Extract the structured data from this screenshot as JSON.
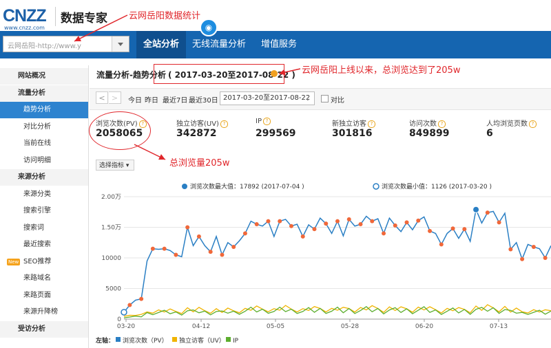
{
  "header": {
    "logo_text": "CNZZ",
    "logo_url": "www.cnzz.com",
    "product": "数据专家",
    "annotation": "云网岳阳数据统计"
  },
  "nav": {
    "site_select_value": "云网岳阳-http://www.y",
    "tabs": [
      "全站分析",
      "无线流量分析",
      "增值服务"
    ],
    "active_tab": 0
  },
  "sidebar": {
    "items": [
      {
        "label": "网站概况",
        "type": "header"
      },
      {
        "label": "流量分析",
        "type": "header"
      },
      {
        "label": "趋势分析",
        "type": "item",
        "active": true
      },
      {
        "label": "对比分析",
        "type": "item"
      },
      {
        "label": "当前在线",
        "type": "item"
      },
      {
        "label": "访问明细",
        "type": "item"
      },
      {
        "label": "来源分析",
        "type": "header"
      },
      {
        "label": "来源分类",
        "type": "item"
      },
      {
        "label": "搜索引擎",
        "type": "item"
      },
      {
        "label": "搜索词",
        "type": "item"
      },
      {
        "label": "最近搜索",
        "type": "item"
      },
      {
        "label": "SEO推荐",
        "type": "item",
        "badge": "New"
      },
      {
        "label": "来路域名",
        "type": "item"
      },
      {
        "label": "来路页面",
        "type": "item"
      },
      {
        "label": "来源升降榜",
        "type": "item"
      },
      {
        "label": "受访分析",
        "type": "header"
      }
    ]
  },
  "content": {
    "page_title": "流量分析-趋势分析",
    "date_range_heading": "( 2017-03-20至2017-08-22 )",
    "annotation_top": "云网岳阳上线以来，总浏览达到了205w",
    "annotation_pv": "总浏览量205w",
    "toolbar": {
      "prev": "<",
      "next": ">",
      "quick": [
        "今日",
        "昨日",
        "最近7日",
        "最近30日"
      ],
      "range_value": "2017-03-20至2017-08-22",
      "compare_label": "对比"
    },
    "metrics": [
      {
        "label": "浏览次数(PV)",
        "value": "2058065"
      },
      {
        "label": "独立访客(UV)",
        "value": "342872"
      },
      {
        "label": "IP",
        "value": "299569"
      },
      {
        "label": "新独立访客",
        "value": "301816"
      },
      {
        "label": "访问次数",
        "value": "849899"
      },
      {
        "label": "人均浏览页数",
        "value": "6"
      }
    ],
    "select_indicator": "选择指标"
  },
  "chart_data": {
    "type": "line",
    "ylim": [
      0,
      20000
    ],
    "y_ticks": [
      "0",
      "5000",
      "10000",
      "1.50万",
      "2.00万"
    ],
    "x_ticks": [
      "03-20",
      "04-12",
      "05-05",
      "05-28",
      "06-20",
      "07-13"
    ],
    "max_label": "浏览次数最大值：17892 (2017-07-04 )",
    "min_label": "浏览次数最小值：1126 (2017-03-20 )",
    "legend_prefix": "左轴：",
    "series": [
      {
        "name": "浏览次数（PV）",
        "color": "#2a7fc4",
        "values": [
          1126,
          2300,
          3100,
          3300,
          9500,
          11500,
          11400,
          11500,
          11200,
          10500,
          10200,
          15000,
          12000,
          13500,
          12000,
          11000,
          13500,
          10500,
          12500,
          11800,
          12800,
          14000,
          16000,
          15500,
          15200,
          16000,
          13500,
          16000,
          16300,
          15200,
          15500,
          13500,
          15400,
          14700,
          16500,
          15600,
          14000,
          16000,
          13600,
          16300,
          15200,
          15500,
          16800,
          16000,
          16400,
          14000,
          16500,
          15300,
          14300,
          15800,
          14600,
          16100,
          16700,
          14400,
          14000,
          12200,
          14000,
          14800,
          13200,
          14700,
          12700,
          17892,
          15700,
          17400,
          17600,
          15800,
          17300,
          11400,
          12500,
          9800,
          12200,
          11800,
          11500,
          10000,
          12000
        ]
      },
      {
        "name": "独立访客（UV）",
        "color": "#f0b400",
        "values": []
      },
      {
        "name": "IP",
        "color": "#5cae2e",
        "values": []
      }
    ]
  },
  "colors": {
    "nav": "#1565b0",
    "accent": "#2e83cf",
    "annotation": "#e0262b"
  }
}
